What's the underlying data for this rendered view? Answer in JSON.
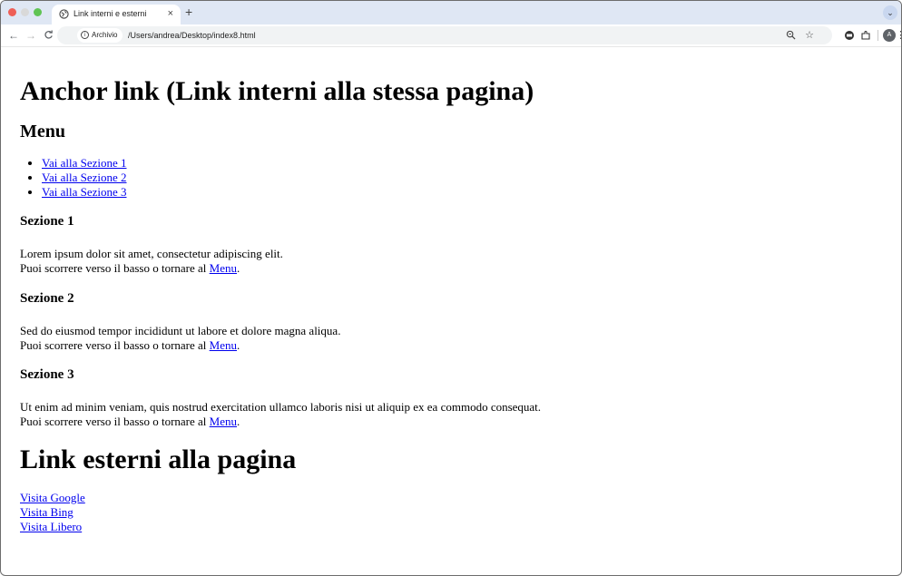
{
  "tab": {
    "title": "Link interni e esterni",
    "close": "×",
    "new_tab": "+"
  },
  "toolbar": {
    "back": "←",
    "forward": "→",
    "reload": "C",
    "chip_label": "Archivio",
    "url": "/Users/andrea/Desktop/index8.html",
    "avatar_letter": "A"
  },
  "page": {
    "h1": "Anchor link (Link interni alla stessa pagina)",
    "menu_heading": "Menu",
    "menu_items": [
      "Vai alla Sezione 1",
      "Vai alla Sezione 2",
      "Vai alla Sezione 3"
    ],
    "sections": [
      {
        "title": "Sezione 1",
        "text": "Lorem ipsum dolor sit amet, consectetur adipiscing elit.",
        "back_prefix": "Puoi scorrere verso il basso o tornare al ",
        "back_link": "Menu",
        "back_suffix": "."
      },
      {
        "title": "Sezione 2",
        "text": "Sed do eiusmod tempor incididunt ut labore et dolore magna aliqua.",
        "back_prefix": "Puoi scorrere verso il basso o tornare al ",
        "back_link": "Menu",
        "back_suffix": "."
      },
      {
        "title": "Sezione 3",
        "text": "Ut enim ad minim veniam, quis nostrud exercitation ullamco laboris nisi ut aliquip ex ea commodo consequat.",
        "back_prefix": "Puoi scorrere verso il basso o tornare al ",
        "back_link": "Menu",
        "back_suffix": "."
      }
    ],
    "external_heading": "Link esterni alla pagina",
    "external_links": [
      "Visita Google",
      "Visita Bing",
      "Visita Libero"
    ]
  },
  "colors": {
    "link": "#0000ee",
    "tabstrip": "#dfe7f4"
  }
}
